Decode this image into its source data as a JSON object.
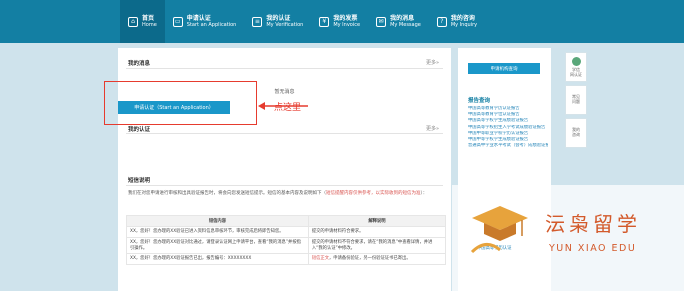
{
  "nav": [
    {
      "cn": "首页",
      "en": "Home",
      "icon": "home-icon"
    },
    {
      "cn": "申请认证",
      "en": "Start an Application",
      "icon": "monitor-icon"
    },
    {
      "cn": "我的认证",
      "en": "My Verification",
      "icon": "document-icon"
    },
    {
      "cn": "我的发票",
      "en": "My Invoice",
      "icon": "invoice-icon"
    },
    {
      "cn": "我的消息",
      "en": "My Message",
      "icon": "message-icon"
    },
    {
      "cn": "我的咨询",
      "en": "My Inquiry",
      "icon": "inquiry-icon"
    }
  ],
  "messages": {
    "title": "我的消息",
    "more": "更多»",
    "empty": "暂无消息"
  },
  "verification": {
    "title": "我的认证",
    "more": "更多»",
    "apply_button": "申请认证（Start an Application）"
  },
  "annotation": {
    "label": "点这里"
  },
  "help": {
    "title": "短信说明",
    "text": "我们在对您申请进行审核和出具验证报告时，将会向您发送短信提示。短信的基本内容及说明如下（",
    "text_red": "短信提醒内容仅供参考，以实际收到的短信为准",
    "text_end": "）："
  },
  "table": {
    "headers": [
      "短信内容",
      "解释说明"
    ],
    "rows": [
      {
        "content": "XX，您好！您办理的XX验证已进入资料信息审核环节，审核完成后将即告知您。",
        "desc": "提交的申请材料符合要求。"
      },
      {
        "content": "XX，您好！您办理的XX验证对比通过，请登录认证网上申请平台，查看“我的消息”并按指引操作。",
        "desc": "提交的申请材料不符合要求，请在“我的消息”中查看详情，并进入“我的认证”中修改。"
      },
      {
        "content": "XX，您好！您办理的XX验证报告已出，报告编号：XXXXXXXX",
        "desc_red": "短信正文",
        "desc": "，申请备份验证，另一份验证证书已寄出。"
      }
    ]
  },
  "right_panel": {
    "button": "申请机构查询",
    "title": "报告查询",
    "links": [
      "中国高等教育学历认证报告",
      "中国高等教育学位认证报告",
      "中国高等学校学生成绩验证报告",
      "中国高等学校招生入学考试成绩验证报告",
      "中国中等职业学校学历认证报告",
      "中国中等学校学生成绩验证报告",
      "普通高中学业水平考试（会考）成绩验证报告"
    ]
  },
  "side_tools": [
    {
      "label": "学信\n网认证",
      "icon": "chsi-badge-icon"
    },
    {
      "label": "常见\n问题"
    },
    {
      "label": "我的\n咨询"
    }
  ],
  "watermark": {
    "cn": "沄枭留学",
    "en": "YUN XIAO EDU",
    "faint": "中国高等学历认证"
  }
}
